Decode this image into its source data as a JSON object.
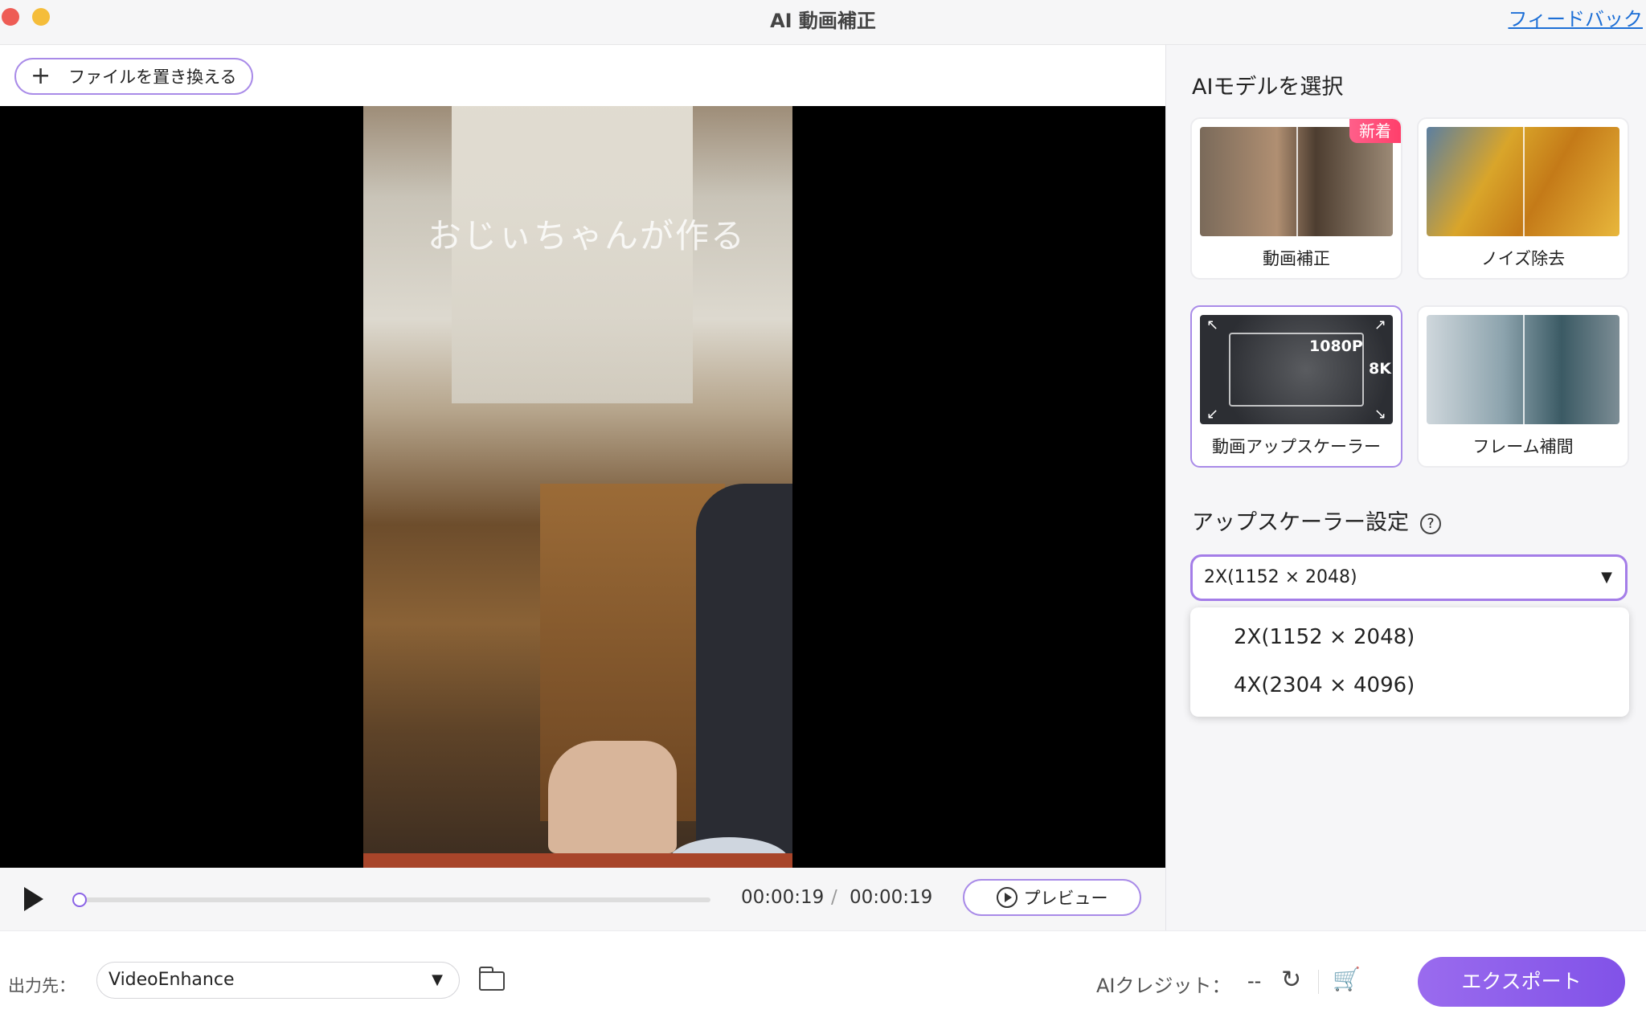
{
  "window": {
    "title": "AI 動画補正",
    "feedback_link": "フィードバック"
  },
  "toolbar": {
    "replace_file": "ファイルを置き換える"
  },
  "video": {
    "overlay_text": "おじぃちゃんが作る",
    "progress": 0.0
  },
  "player": {
    "current_time": "00:00:19",
    "separator": "/",
    "total_time": "00:00:19",
    "preview_label": "プレビュー"
  },
  "model_panel": {
    "title": "AIモデルを選択",
    "models": [
      {
        "label": "動画補正",
        "badge": "新着",
        "selected": false
      },
      {
        "label": "ノイズ除去",
        "selected": false
      },
      {
        "label": "動画アップスケーラー",
        "selected": true,
        "thumb_text_1": "1080P",
        "thumb_text_2": "8K"
      },
      {
        "label": "フレーム補間",
        "selected": false
      }
    ]
  },
  "upscaler": {
    "title": "アップスケーラー設定",
    "help": "?",
    "selected": "2X(1152 × 2048)",
    "options": [
      "2X(1152 × 2048)",
      "4X(2304 × 4096)"
    ]
  },
  "footer": {
    "output_label": "出力先：",
    "output_path": "VideoEnhance",
    "ai_credit_label": "AIクレジット：",
    "ai_credit_value": "--",
    "export_label": "エクスポート"
  },
  "colors": {
    "accent": "#8b63e6",
    "accent_border": "#a98be8",
    "badge": "#ff4775"
  }
}
